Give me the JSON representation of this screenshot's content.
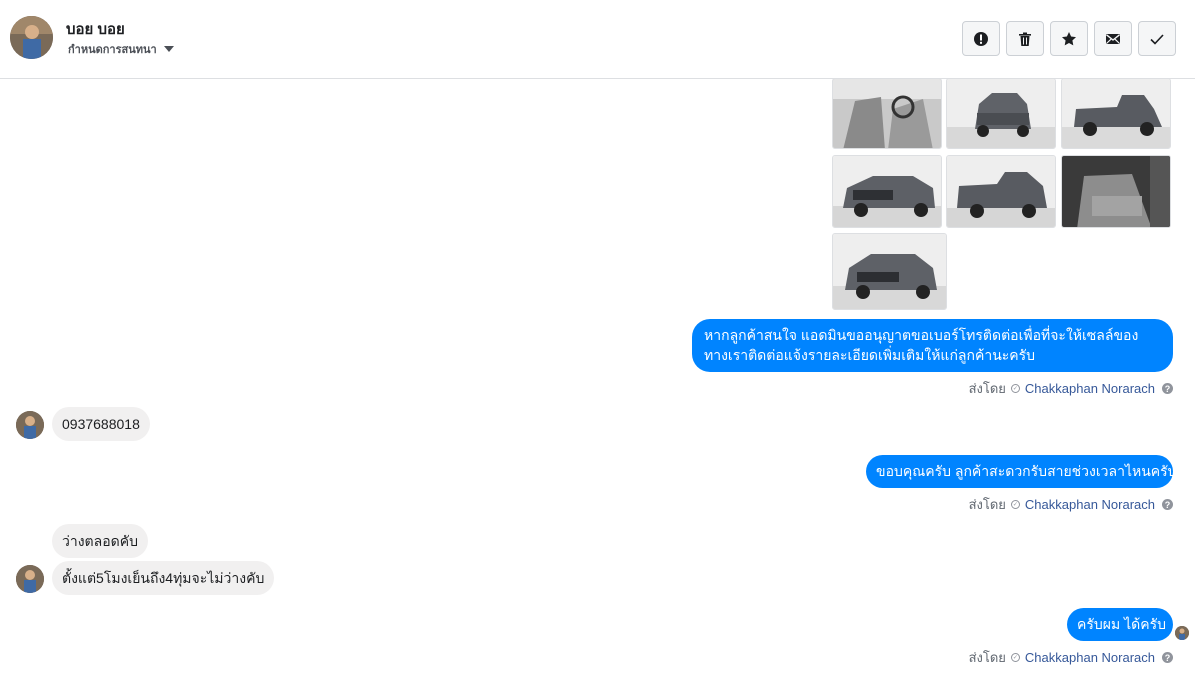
{
  "header": {
    "name": "บอย บอย",
    "subtitle": "กำหนดการสนทนา",
    "actions": [
      {
        "name": "report-icon"
      },
      {
        "name": "trash-icon"
      },
      {
        "name": "star-icon"
      },
      {
        "name": "mail-icon"
      },
      {
        "name": "check-icon"
      }
    ]
  },
  "colors": {
    "outgoing_bubble": "#0084ff",
    "incoming_bubble": "#f1f0f0",
    "agent_link": "#365899"
  },
  "messages": {
    "out1": "หากลูกค้าสนใจ แอดมินขออนุญาตขอเบอร์โทรติดต่อเพื่อที่จะให้เซลล์ของทางเราติดต่อแจ้งรายละเอียดเพิ่มเติมให้แก่ลูกค้านะครับ",
    "in1": "0937688018",
    "out2": "ขอบคุณครับ ลูกค้าสะดวกรับสายช่วงเวลาไหนครับ",
    "in2": "ว่างตลอดคับ",
    "in3": "ตั้งแต่5โมงเย็นถึง4ทุ่มจะไม่ว่างคับ",
    "out3": "ครับผม ได้ครับ"
  },
  "sent_by": {
    "label": "ส่งโดย",
    "agent": "Chakkaphan Norarach",
    "help": "?"
  }
}
